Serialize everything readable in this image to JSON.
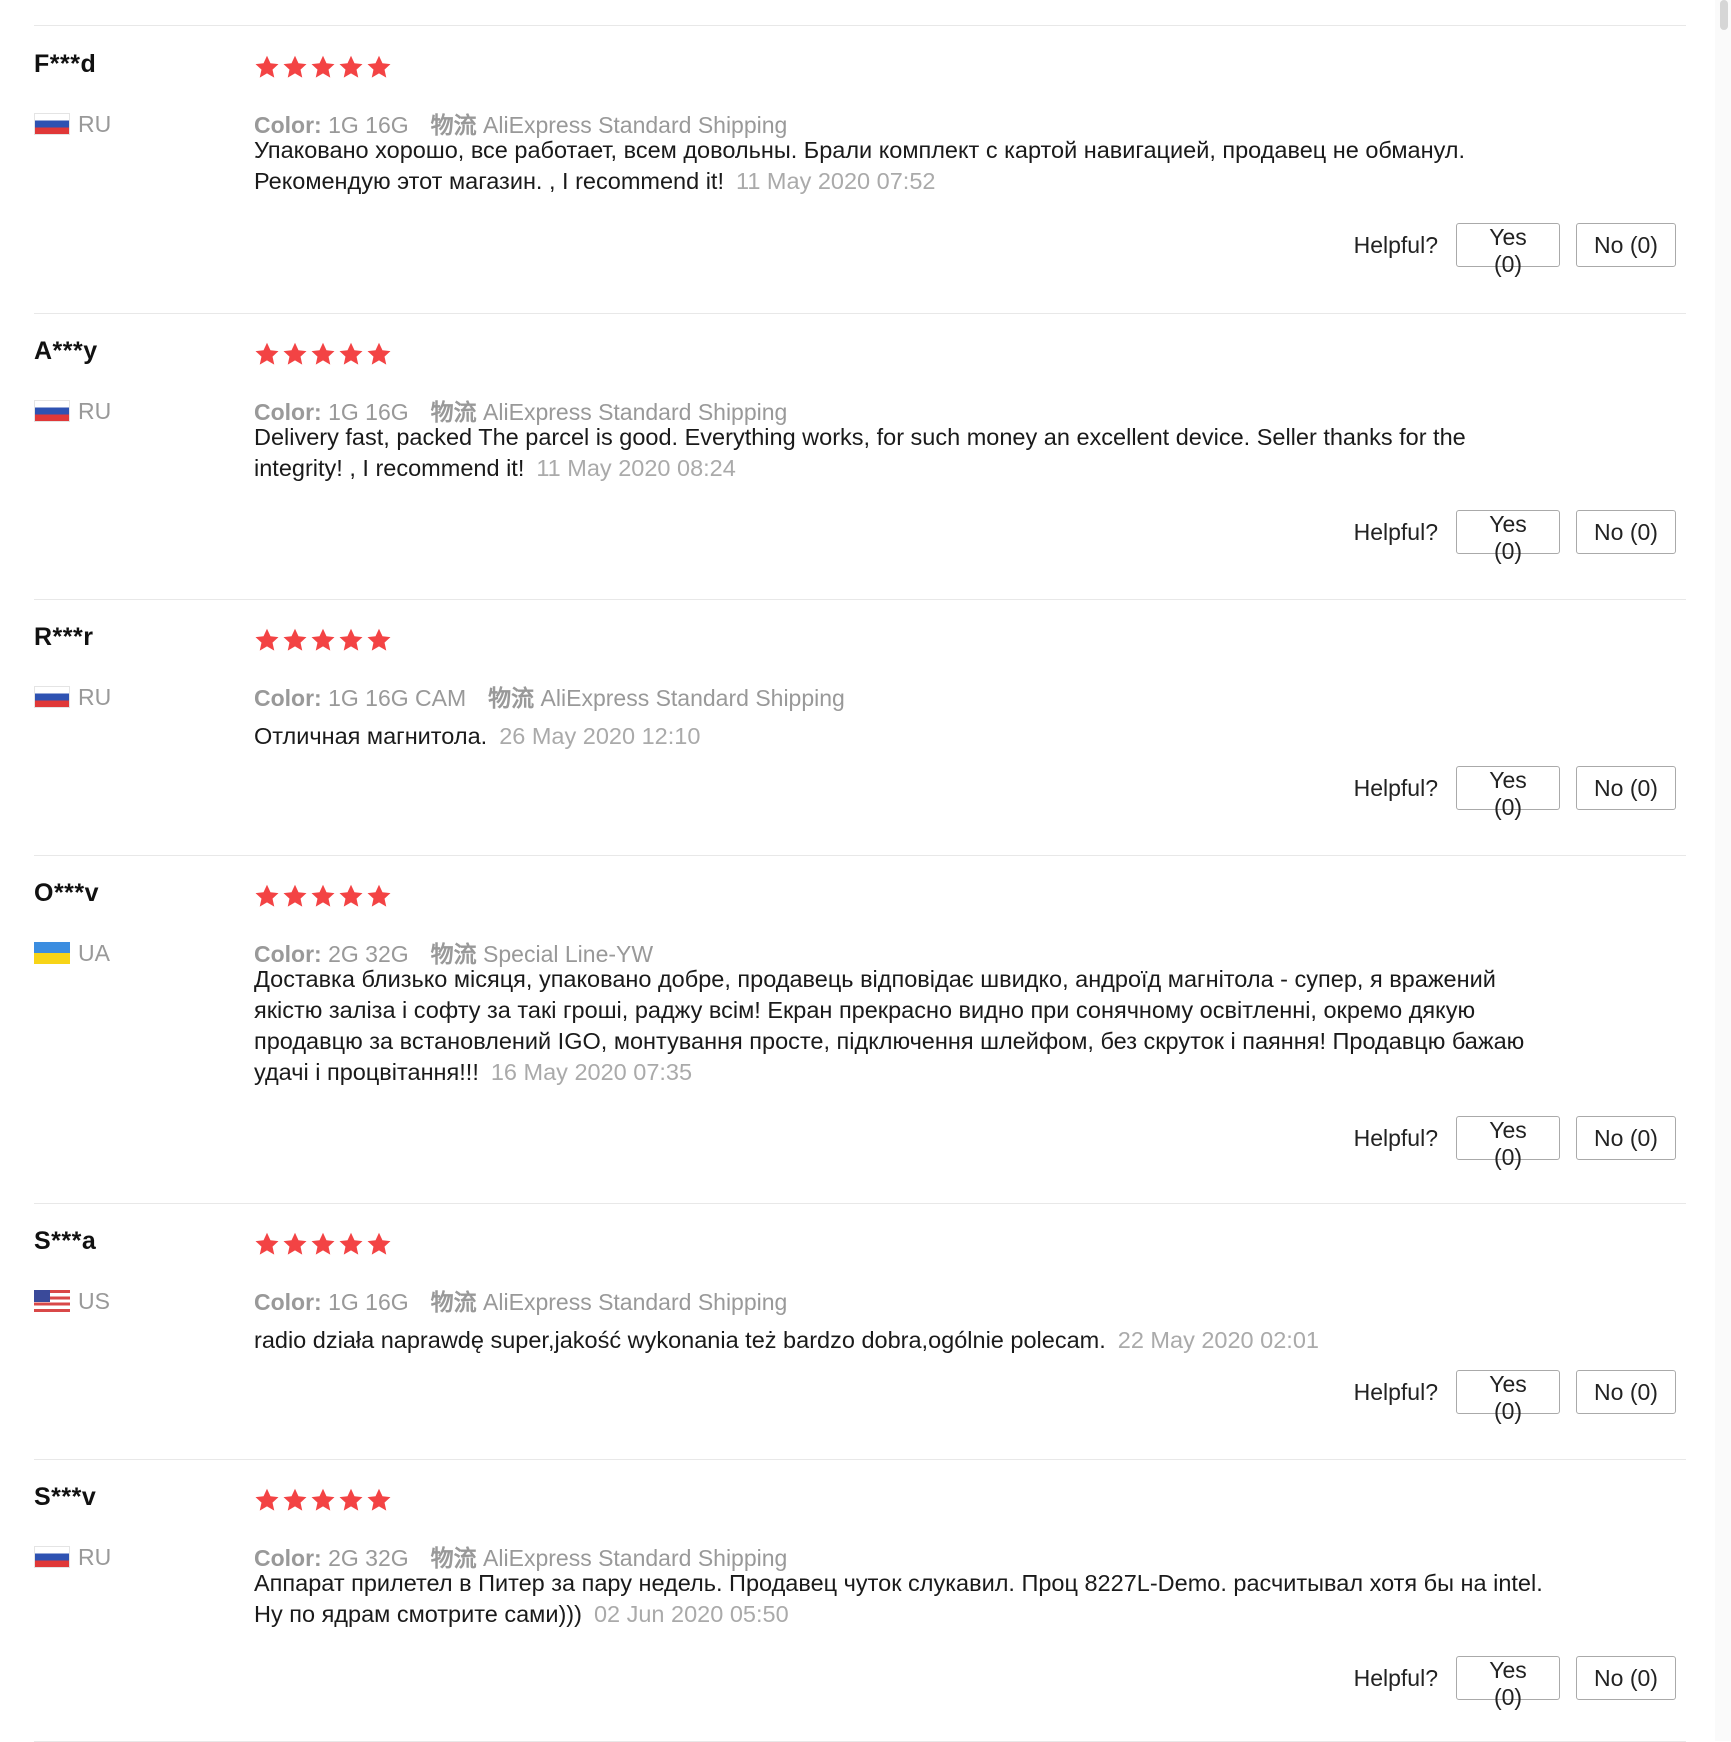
{
  "colors": {
    "star": "#f34344",
    "muted": "#999999",
    "text": "#1a1a1a",
    "border": "#e8e8e8"
  },
  "reviews": [
    {
      "user": "F***d",
      "country": "RU",
      "rating": 5,
      "color_label": "Color:",
      "color_value": "1G 16G",
      "shipping_label": "物流",
      "shipping_value": "AliExpress Standard Shipping",
      "feedback": "Упаковано хорошо, все работает, всем довольны. Брали комплект с картой навигацией, продавец не обманул. Рекомендую этот магазин. , I recommend it!",
      "date": "11 May 2020 07:52",
      "helpful_label": "Helpful?",
      "yes_label": "Yes (0)",
      "no_label": "No (0)"
    },
    {
      "user": "A***y",
      "country": "RU",
      "rating": 5,
      "color_label": "Color:",
      "color_value": "1G 16G",
      "shipping_label": "物流",
      "shipping_value": "AliExpress Standard Shipping",
      "feedback": "Delivery fast, packed The parcel is good. Everything works, for such money an excellent device. Seller thanks for the integrity! , I recommend it!",
      "date": "11 May 2020 08:24",
      "helpful_label": "Helpful?",
      "yes_label": "Yes (0)",
      "no_label": "No (0)"
    },
    {
      "user": "R***r",
      "country": "RU",
      "rating": 5,
      "color_label": "Color:",
      "color_value": "1G 16G CAM",
      "shipping_label": "物流",
      "shipping_value": "AliExpress Standard Shipping",
      "feedback": "Отличная магнитола.",
      "date": "26 May 2020 12:10",
      "helpful_label": "Helpful?",
      "yes_label": "Yes (0)",
      "no_label": "No (0)"
    },
    {
      "user": "O***v",
      "country": "UA",
      "rating": 5,
      "color_label": "Color:",
      "color_value": "2G 32G",
      "shipping_label": "物流",
      "shipping_value": "Special Line-YW",
      "feedback": "Доставка близько місяця, упаковано добре, продавець відповідає швидко, андроїд магнітола - супер, я вражений якістю заліза і софту за такі гроші, раджу всім! Екран прекрасно видно при сонячному освітленні, окремо дякую продавцю за встановлений IGO, монтування просте, підключення шлейфом, без скруток і паяння! Продавцю бажаю удачі і процвітання!!!",
      "date": "16 May 2020 07:35",
      "helpful_label": "Helpful?",
      "yes_label": "Yes (0)",
      "no_label": "No (0)"
    },
    {
      "user": "S***a",
      "country": "US",
      "rating": 5,
      "color_label": "Color:",
      "color_value": "1G 16G",
      "shipping_label": "物流",
      "shipping_value": "AliExpress Standard Shipping",
      "feedback": "radio działa naprawdę super,jakość wykonania też bardzo dobra,ogólnie polecam.",
      "date": "22 May 2020 02:01",
      "helpful_label": "Helpful?",
      "yes_label": "Yes (0)",
      "no_label": "No (0)"
    },
    {
      "user": "S***v",
      "country": "RU",
      "rating": 5,
      "color_label": "Color:",
      "color_value": "2G 32G",
      "shipping_label": "物流",
      "shipping_value": "AliExpress Standard Shipping",
      "feedback": "Аппарат прилетел в Питер за пару недель. Продавец чуток слукавил. Проц 8227L-Demo. расчитывал хотя бы на intel. Ну по ядрам смотрите сами)))",
      "date": "02 Jun 2020 05:50",
      "helpful_label": "Helpful?",
      "yes_label": "Yes (0)",
      "no_label": "No (0)"
    }
  ]
}
